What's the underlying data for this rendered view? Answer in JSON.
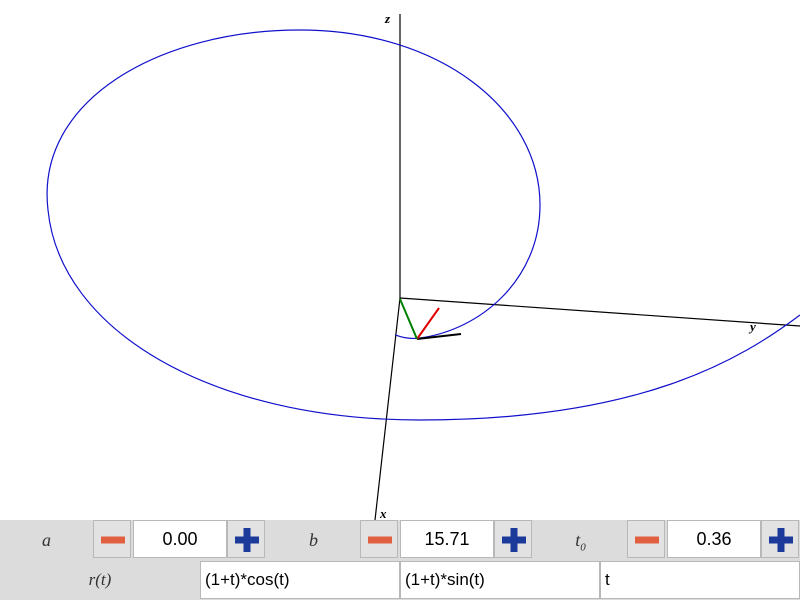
{
  "plot": {
    "axis_labels": {
      "x": "x",
      "y": "y",
      "z": "z"
    },
    "curve_color": "#1010cc",
    "tangent_color": "#000000",
    "normal_color": "#e00000",
    "binormal_color": "#008000"
  },
  "params": {
    "a": {
      "label": "a",
      "value": "0.00"
    },
    "b": {
      "label": "b",
      "value": "15.71"
    },
    "t0": {
      "label": "t",
      "sub": "0",
      "value": "0.36"
    }
  },
  "buttons": {
    "minus_color": "#e06040",
    "plus_color": "#1c3a9a"
  },
  "function": {
    "label": "r(t)",
    "x_expr": "(1+t)*cos(t)",
    "y_expr": "(1+t)*sin(t)",
    "z_expr": "t"
  }
}
